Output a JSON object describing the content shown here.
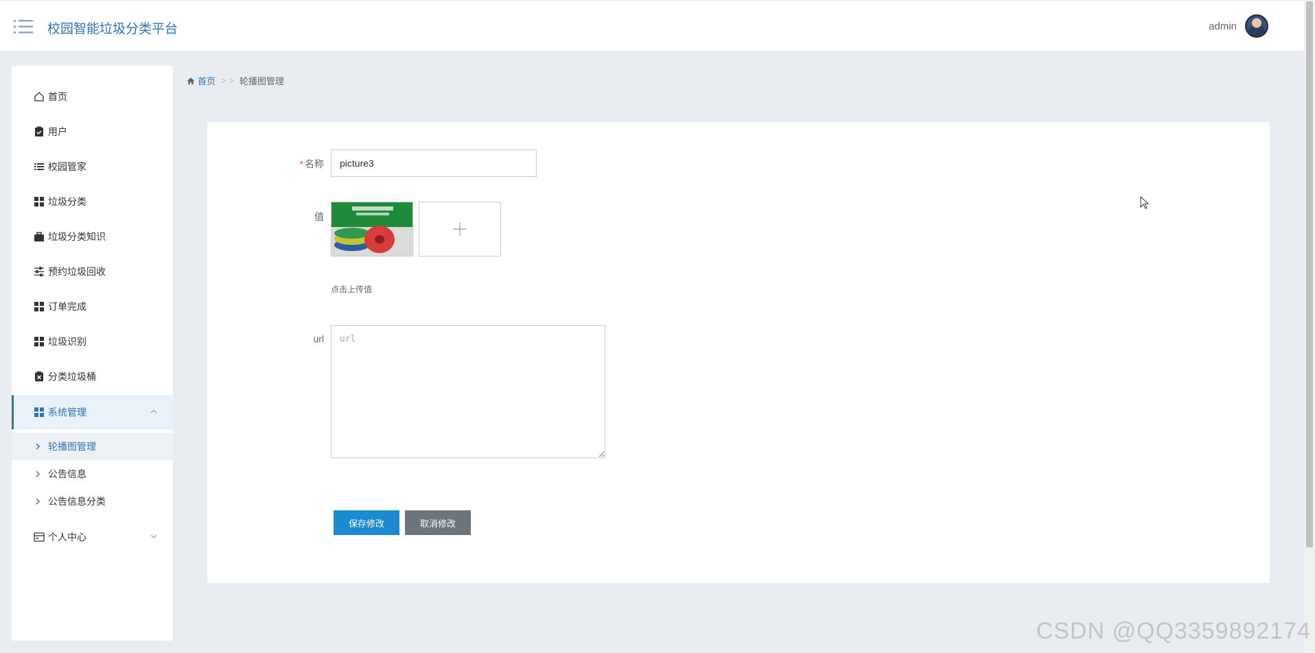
{
  "header": {
    "app_title": "校园智能垃圾分类平台",
    "user_name": "admin"
  },
  "sidebar": {
    "items": [
      {
        "label": "首页",
        "icon": "home-icon"
      },
      {
        "label": "用户",
        "icon": "clipboard-check-icon"
      },
      {
        "label": "校园管家",
        "icon": "list-icon"
      },
      {
        "label": "垃圾分类",
        "icon": "grid-icon"
      },
      {
        "label": "垃圾分类知识",
        "icon": "briefcase-icon"
      },
      {
        "label": "预约垃圾回收",
        "icon": "sliders-icon"
      },
      {
        "label": "订单完成",
        "icon": "grid-icon"
      },
      {
        "label": "垃圾识别",
        "icon": "grid-icon"
      },
      {
        "label": "分类垃圾桶",
        "icon": "clipboard-x-icon"
      },
      {
        "label": "系统管理",
        "icon": "grid-icon",
        "expanded": true
      },
      {
        "label": "个人中心",
        "icon": "wallet-icon",
        "expanded": false
      }
    ],
    "sub_items": [
      {
        "label": "轮播图管理",
        "active": true
      },
      {
        "label": "公告信息",
        "active": false
      },
      {
        "label": "公告信息分类",
        "active": false
      }
    ]
  },
  "breadcrumb": {
    "home": "首页",
    "separator": "> >",
    "current": "轮播图管理"
  },
  "form": {
    "name_label": "名称",
    "name_required_mark": "*",
    "name_value": "picture3",
    "value_label": "值",
    "upload_hint": "点击上传值",
    "url_label": "url",
    "url_placeholder": "url",
    "save_label": "保存修改",
    "cancel_label": "取消修改"
  },
  "colors": {
    "accent": "#2f74b5",
    "save_button": "#1a8bd0",
    "cancel_button": "#6c757d",
    "background": "#e9ecf0"
  },
  "watermark": "CSDN @QQ3359892174"
}
